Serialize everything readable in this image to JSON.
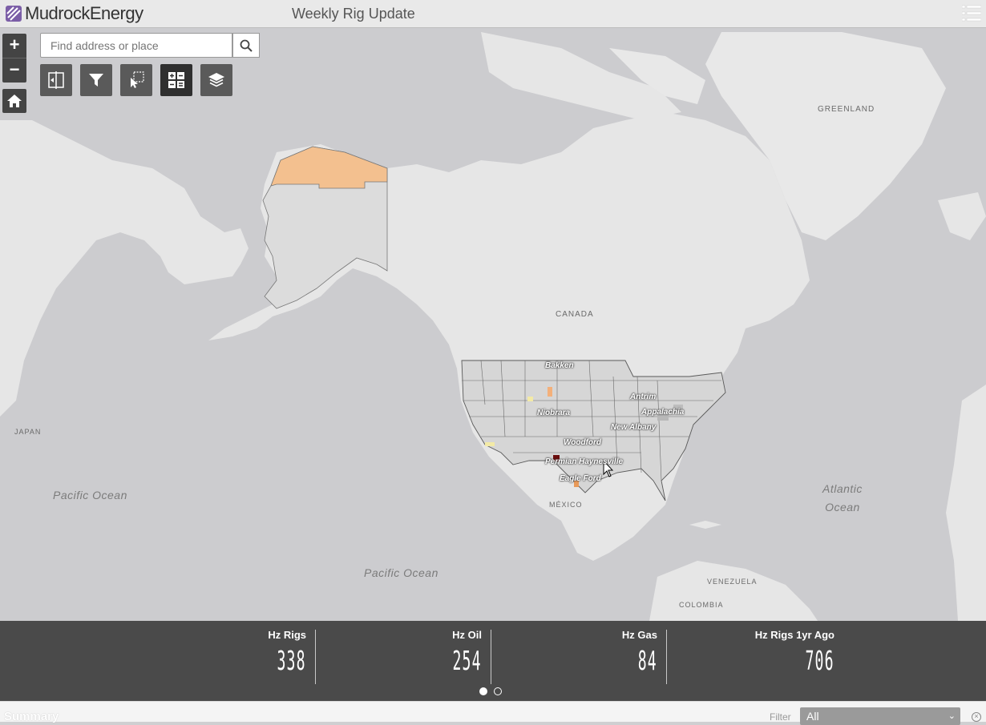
{
  "header": {
    "logo_text": "MudrockEnergy",
    "title": "Weekly Rig Update"
  },
  "search": {
    "placeholder": "Find address or place"
  },
  "zoom": {
    "in_label": "+",
    "out_label": "−"
  },
  "map": {
    "labels": {
      "greenland": "GREENLAND",
      "canada": "CANADA",
      "japan": "JAPAN",
      "mexico": "MÉXICO",
      "venezuela": "VENEZUELA",
      "colombia": "COLOMBIA"
    },
    "oceans": {
      "pacific_west": "Pacific Ocean",
      "pacific_south": "Pacific Ocean",
      "atlantic_line1": "Atlantic",
      "atlantic_line2": "Ocean"
    },
    "plays": {
      "bakken": "Bakken",
      "niobrara": "Niobrara",
      "antrim": "Antrim",
      "appalachia": "Appalachia",
      "new_albany": "New Albany",
      "woodford": "Woodford",
      "permian": "Permian",
      "haynesville": "Haynesville",
      "eagle_ford": "Eagle Ford"
    },
    "colors": {
      "alaska_north": "#f3c08f",
      "land": "#e6e6e6",
      "water": "#cccccf",
      "us_states": "#d6d6d6"
    }
  },
  "stats": [
    {
      "label": "Hz Rigs",
      "value": "338"
    },
    {
      "label": "Hz Oil",
      "value": "254"
    },
    {
      "label": "Hz Gas",
      "value": "84"
    },
    {
      "label": "Hz Rigs 1yr Ago",
      "value": "706"
    }
  ],
  "pager": {
    "pages": 2,
    "current": 1
  },
  "summary": {
    "title": "Summary",
    "filter_label": "Filter",
    "filter_value": "All"
  }
}
